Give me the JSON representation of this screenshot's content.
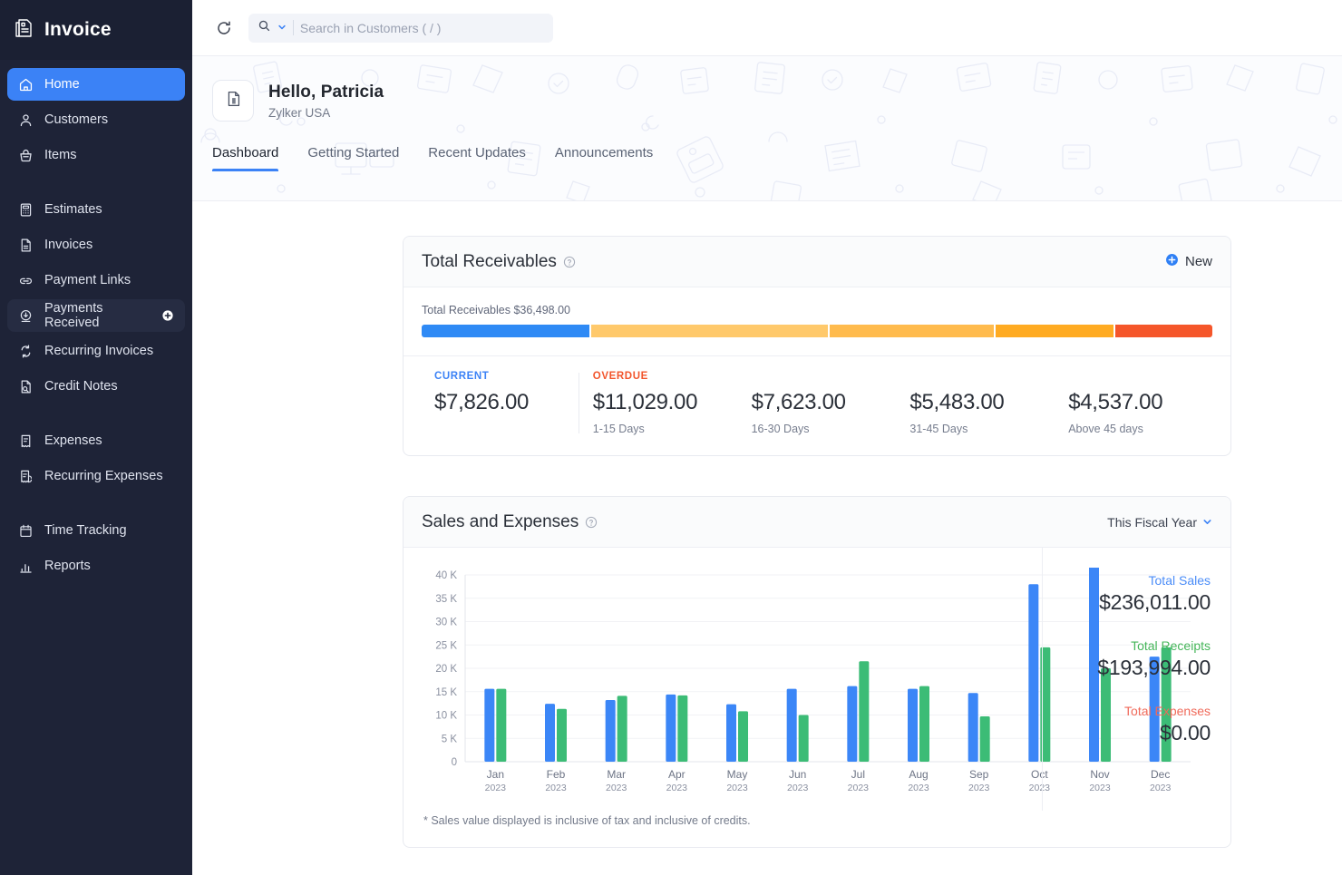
{
  "sidebar": {
    "brand": "Invoice",
    "brand_icon": "invoice-document-icon",
    "items": [
      {
        "label": "Home",
        "icon": "home-icon",
        "state": "active"
      },
      {
        "label": "Customers",
        "icon": "user-icon",
        "state": "normal"
      },
      {
        "label": "Items",
        "icon": "basket-icon",
        "state": "normal"
      },
      {
        "label": "Estimates",
        "icon": "calculator-icon",
        "state": "normal",
        "gap_before": true
      },
      {
        "label": "Invoices",
        "icon": "file-icon",
        "state": "normal"
      },
      {
        "label": "Payment Links",
        "icon": "link-icon",
        "state": "normal"
      },
      {
        "label": "Payments Received",
        "icon": "download-circle-icon",
        "state": "hover",
        "trailing_icon": "plus-circle-icon"
      },
      {
        "label": "Recurring Invoices",
        "icon": "recurring-icon",
        "state": "normal"
      },
      {
        "label": "Credit Notes",
        "icon": "credit-note-icon",
        "state": "normal"
      },
      {
        "label": "Expenses",
        "icon": "receipt-icon",
        "state": "normal",
        "gap_before": true
      },
      {
        "label": "Recurring Expenses",
        "icon": "recurring-receipt-icon",
        "state": "normal"
      },
      {
        "label": "Time Tracking",
        "icon": "calendar-icon",
        "state": "normal",
        "gap_before": true
      },
      {
        "label": "Reports",
        "icon": "bar-chart-icon",
        "state": "normal"
      }
    ]
  },
  "topbar": {
    "refresh_icon": "refresh-icon",
    "search_icon": "search-icon",
    "search_dropdown_icon": "chevron-down-icon",
    "search_value": "",
    "search_placeholder": "Search in Customers ( / )"
  },
  "banner": {
    "org_icon": "organization-icon",
    "greeting": "Hello, Patricia",
    "org_name": "Zylker USA",
    "tabs": [
      {
        "label": "Dashboard",
        "active": true
      },
      {
        "label": "Getting Started",
        "active": false
      },
      {
        "label": "Recent Updates",
        "active": false
      },
      {
        "label": "Announcements",
        "active": false
      }
    ]
  },
  "receivables": {
    "title": "Total Receivables",
    "help_icon": "help-circle-icon",
    "new_label": "New",
    "new_icon": "plus-circle-icon",
    "bar_label": "Total Receivables $36,498.00",
    "total": "$36,498.00",
    "segments": [
      {
        "name": "current",
        "color": "#2f8af5",
        "value": 7826,
        "pct": 21.4
      },
      {
        "name": "1-15 days",
        "color": "#ffc96b",
        "value": 11029,
        "pct": 30.2
      },
      {
        "name": "16-30 days",
        "color": "#ffbb4d",
        "value": 7623,
        "pct": 20.9
      },
      {
        "name": "31-45 days",
        "color": "#ffab22",
        "value": 5483,
        "pct": 15.0
      },
      {
        "name": "above 45 days",
        "color": "#f5562a",
        "value": 4537,
        "pct": 12.4
      }
    ],
    "columns": [
      {
        "tag": "CURRENT",
        "tag_type": "current",
        "amount": "$7,826.00",
        "sub": ""
      },
      {
        "tag": "OVERDUE",
        "tag_type": "overdue",
        "amount": "$11,029.00",
        "sub": "1-15 Days"
      },
      {
        "tag": "",
        "tag_type": "none",
        "amount": "$7,623.00",
        "sub": "16-30 Days"
      },
      {
        "tag": "",
        "tag_type": "none",
        "amount": "$5,483.00",
        "sub": "31-45 Days"
      },
      {
        "tag": "",
        "tag_type": "none",
        "amount": "$4,537.00",
        "sub": "Above 45 days"
      }
    ]
  },
  "sales_expenses": {
    "title": "Sales and Expenses",
    "help_icon": "help-circle-icon",
    "period": "This Fiscal Year",
    "period_icon": "chevron-down-icon",
    "totals": [
      {
        "label": "Total Sales",
        "value": "$236,011.00",
        "type": "sales"
      },
      {
        "label": "Total Receipts",
        "value": "$193,994.00",
        "type": "receipts"
      },
      {
        "label": "Total Expenses",
        "value": "$0.00",
        "type": "expenses"
      }
    ],
    "note": "* Sales value displayed is inclusive of tax and inclusive of credits."
  },
  "chart_data": {
    "type": "bar",
    "title": "Sales and Expenses",
    "xlabel": "",
    "ylabel": "",
    "ylim": [
      0,
      40000
    ],
    "yticks": [
      0,
      5000,
      10000,
      15000,
      20000,
      25000,
      30000,
      35000,
      40000
    ],
    "ytick_labels": [
      "0",
      "5 K",
      "10 K",
      "15 K",
      "20 K",
      "25 K",
      "30 K",
      "35 K",
      "40 K"
    ],
    "grid": true,
    "legend_position": "none",
    "categories": [
      "Jan",
      "Feb",
      "Mar",
      "Apr",
      "May",
      "Jun",
      "Jul",
      "Aug",
      "Sep",
      "Oct",
      "Nov",
      "Dec"
    ],
    "category_years": [
      "2023",
      "2023",
      "2023",
      "2023",
      "2023",
      "2023",
      "2023",
      "2023",
      "2023",
      "2023",
      "2023",
      "2023"
    ],
    "series": [
      {
        "name": "Sales",
        "color": "#3b86f7",
        "values": [
          15600,
          12400,
          13200,
          14400,
          12300,
          15600,
          16200,
          15600,
          14700,
          38000,
          45000,
          22500
        ]
      },
      {
        "name": "Receipts",
        "color": "#3cbc76",
        "values": [
          15600,
          11300,
          14100,
          14200,
          10800,
          10000,
          21500,
          16200,
          9700,
          24500,
          20000,
          24500
        ]
      }
    ]
  }
}
